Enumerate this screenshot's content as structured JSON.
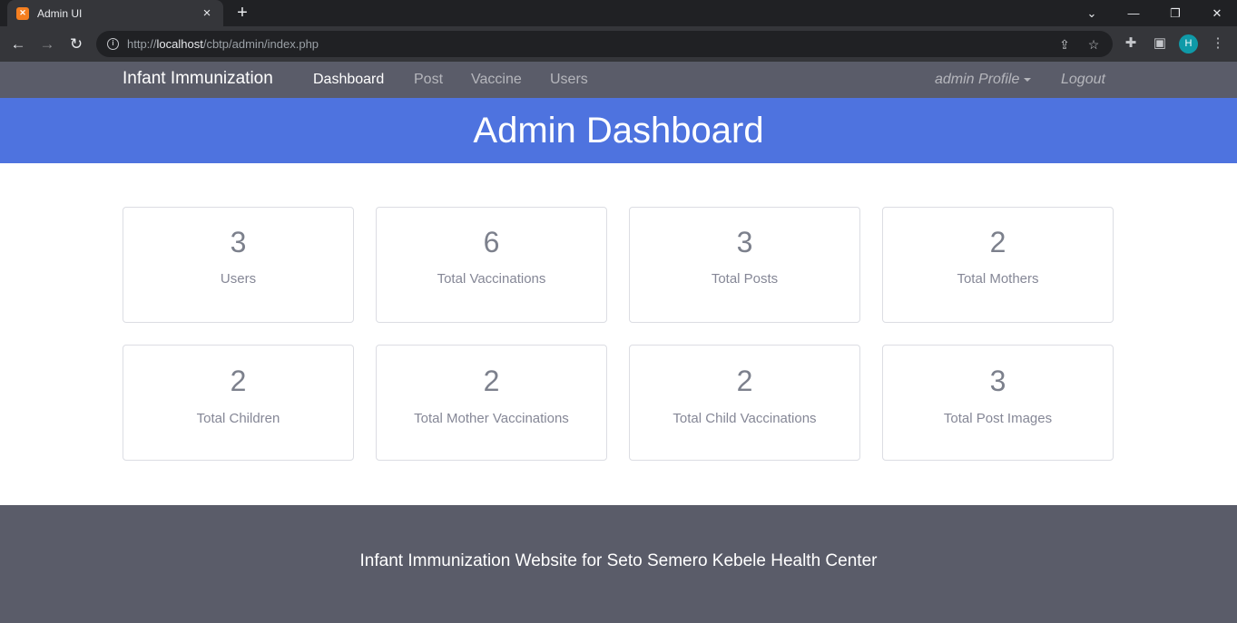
{
  "browser": {
    "tab_title": "Admin UI",
    "tab_favicon": "xampp-icon",
    "url_scheme": "http://",
    "url_host": "localhost",
    "url_path": "/cbtp/admin/index.php",
    "profile_initial": "H"
  },
  "navbar": {
    "brand": "Infant Immunization",
    "links": [
      "Dashboard",
      "Post",
      "Vaccine",
      "Users"
    ],
    "active": "Dashboard",
    "profile": "admin Profile",
    "logout": "Logout"
  },
  "header": {
    "title": "Admin Dashboard"
  },
  "stats": [
    {
      "value": "3",
      "label": "Users"
    },
    {
      "value": "6",
      "label": "Total Vaccinations"
    },
    {
      "value": "3",
      "label": "Total Posts"
    },
    {
      "value": "2",
      "label": "Total Mothers"
    },
    {
      "value": "2",
      "label": "Total Children"
    },
    {
      "value": "2",
      "label": "Total Mother Vaccinations"
    },
    {
      "value": "2",
      "label": "Total Child Vaccinations"
    },
    {
      "value": "3",
      "label": "Total Post Images"
    }
  ],
  "footer": {
    "text": "Infant Immunization Website for Seto Semero Kebele Health Center"
  },
  "colors": {
    "navbar": "#5a5c69",
    "header": "#4e73df",
    "footer": "#5a5c69"
  }
}
